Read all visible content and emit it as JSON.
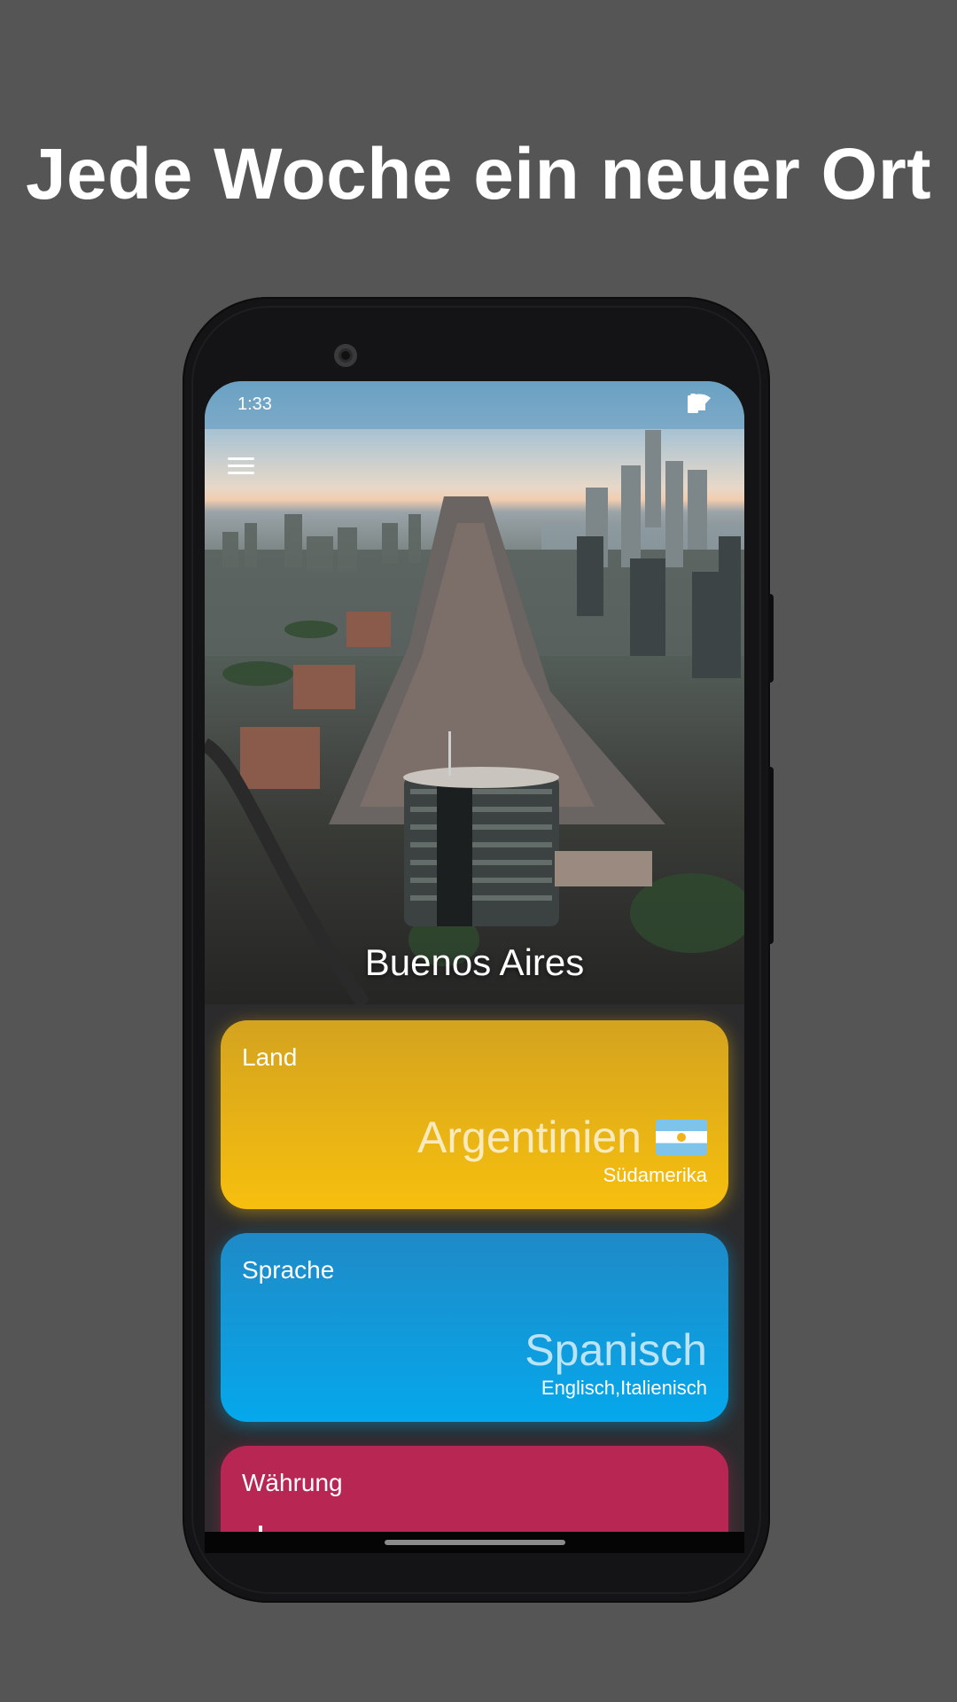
{
  "headline": "Jede Woche ein neuer Ort",
  "status_bar": {
    "time": "1:33",
    "icons": [
      "notifications-off-icon",
      "wifi-icon",
      "cell-signal-icon",
      "battery-icon"
    ]
  },
  "hero": {
    "city": "Buenos Aires",
    "menu_icon": "hamburger-menu-icon"
  },
  "cards": {
    "land": {
      "label": "Land",
      "value": "Argentinien",
      "flag": "argentina-flag-icon",
      "sub": "Südamerika",
      "color": "#f7bf0e"
    },
    "sprache": {
      "label": "Sprache",
      "value": "Spanisch",
      "sub": "Englisch,Italienisch",
      "color": "#05a8ec"
    },
    "waehrung": {
      "label": "Währung",
      "color": "#b82654"
    }
  },
  "colors": {
    "background": "#555555",
    "phone": "#141416"
  }
}
